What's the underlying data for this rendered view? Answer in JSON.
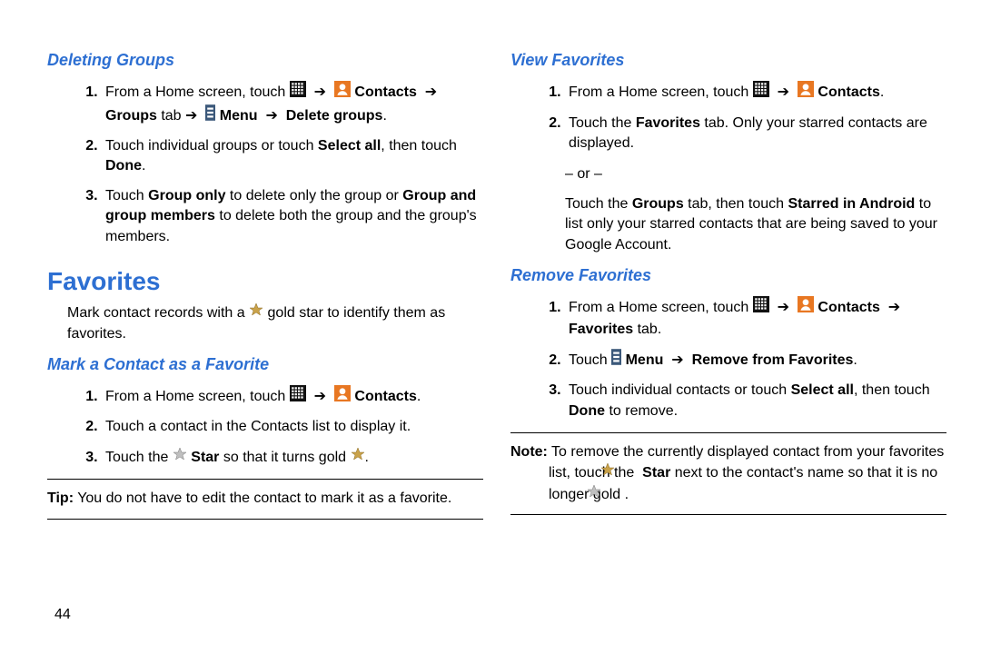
{
  "page_number": "44",
  "arrow": "➔",
  "or_sep": "– or –",
  "left": {
    "h_deleting": "Deleting Groups",
    "dg_1_pre": "From a Home screen, touch ",
    "dg_1_contacts": "Contacts",
    "dg_1_groups_tab": "Groups",
    "dg_1_tab_word": " tab ",
    "dg_1_menu": "Menu",
    "dg_1_delete": "Delete groups",
    "dg_2_a": "Touch individual groups or touch ",
    "dg_2_select_all": "Select all",
    "dg_2_b": ", then touch ",
    "dg_2_done": "Done",
    "dg_3_a": "Touch ",
    "dg_3_group_only": "Group only",
    "dg_3_b": " to delete only the group or ",
    "dg_3_group_members": "Group and group members",
    "dg_3_c": " to delete both the group and the group's members.",
    "h_favorites": "Favorites",
    "fav_intro_a": "Mark contact records with a ",
    "fav_intro_b": " gold star to identify them as favorites.",
    "h_mark": "Mark a Contact as a Favorite",
    "mk_1_pre": "From a Home screen, touch ",
    "mk_1_contacts": "Contacts",
    "mk_2": "Touch a contact in the Contacts list to display it.",
    "mk_3_a": "Touch the ",
    "mk_3_star": "Star",
    "mk_3_b": " so that it turns gold ",
    "tip_label": "Tip:",
    "tip_text": " You do not have to edit the contact to mark it as a favorite."
  },
  "right": {
    "h_view": "View Favorites",
    "vf_1_pre": "From a Home screen, touch ",
    "vf_1_contacts": "Contacts",
    "vf_2_a": "Touch the ",
    "vf_2_fav": "Favorites",
    "vf_2_b": " tab. Only your starred contacts are displayed.",
    "vf_or_a": "Touch the ",
    "vf_or_groups": "Groups",
    "vf_or_b": " tab, then touch ",
    "vf_or_starred": "Starred in Android",
    "vf_or_c": " to list only your starred contacts that are being saved to your Google Account.",
    "h_remove": "Remove Favorites",
    "rf_1_pre": "From a Home screen, touch ",
    "rf_1_contacts": "Contacts",
    "rf_1_fav_tab": "Favorites",
    "rf_1_tab_word": " tab.",
    "rf_2_a": "Touch ",
    "rf_2_menu": "Menu",
    "rf_2_remove": "Remove from Favorites",
    "rf_3_a": "Touch individual contacts or touch ",
    "rf_3_select_all": "Select all",
    "rf_3_b": ", then touch ",
    "rf_3_done": "Done",
    "rf_3_c": " to remove.",
    "note_label": "Note:",
    "note_a": " To remove the currently displayed contact from your favorites list, touch the ",
    "note_star": "Star",
    "note_b": " next to the contact's name so that it is no longer gold ",
    "period": "."
  }
}
